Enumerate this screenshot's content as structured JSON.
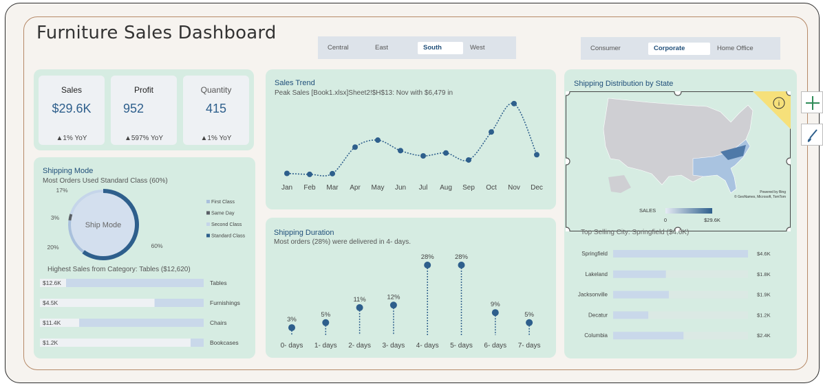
{
  "dashboard": {
    "title": "Furniture Sales Dashboard"
  },
  "region_slicer": {
    "options": [
      "Central",
      "East",
      "South",
      "West"
    ],
    "selected": "South"
  },
  "segment_slicer": {
    "options": [
      "Consumer",
      "Corporate",
      "Home Office"
    ],
    "selected": "Corporate"
  },
  "kpis": [
    {
      "label": "Sales",
      "value": "$29.6K",
      "yoy": "▲1% YoY"
    },
    {
      "label": "Profit",
      "value": "952",
      "yoy": "▲597% YoY"
    },
    {
      "label": "Quantity",
      "value": "415",
      "yoy": "▲1% YoY"
    }
  ],
  "sales_trend": {
    "title": "Sales Trend",
    "subtitle": "Peak Sales [Book1.xlsx]Sheet2!$H$13: Nov with $6,479 in",
    "chart_data": {
      "type": "line",
      "categories": [
        "Jan",
        "Feb",
        "Mar",
        "Apr",
        "May",
        "Jun",
        "Jul",
        "Aug",
        "Sep",
        "Oct",
        "Nov",
        "Dec"
      ],
      "values": [
        500,
        420,
        480,
        2750,
        3350,
        2450,
        2000,
        2250,
        1650,
        4050,
        6479,
        2100
      ],
      "ylim": [
        0,
        7000
      ],
      "color": "#2e5f8c"
    }
  },
  "shipping_mode": {
    "title": "Shipping Mode",
    "subtitle": "Most Orders Used Standard Class (60%)",
    "center_label": "Ship Mode",
    "chart_data": {
      "type": "pie",
      "categories": [
        "First Class",
        "Same Day",
        "Second Class",
        "Standard Class"
      ],
      "values": [
        17,
        3,
        20,
        60
      ],
      "labels": [
        "17%",
        "3%",
        "20%",
        "60%"
      ],
      "colors": [
        "#a9c0dc",
        "#5a5f66",
        "#c5d5ea",
        "#2e5f8c"
      ]
    }
  },
  "category_sales": {
    "title": "Highest Sales from Category: Tables ($12,620)",
    "chart_data": {
      "type": "bar",
      "categories": [
        "Tables",
        "Furnishings",
        "Chairs",
        "Bookcases"
      ],
      "values": [
        12.6,
        4.5,
        11.4,
        1.2
      ],
      "labels": [
        "$12.6K",
        "$4.5K",
        "$11.4K",
        "$1.2K"
      ]
    }
  },
  "shipping_duration": {
    "title": "Shipping Duration",
    "subtitle": "Most orders (28%) were delivered in 4- days.",
    "chart_data": {
      "type": "scatter",
      "categories": [
        "0- days",
        "1- days",
        "2- days",
        "3- days",
        "4- days",
        "5- days",
        "6- days",
        "7- days"
      ],
      "values": [
        3,
        5,
        11,
        12,
        28,
        28,
        9,
        5
      ],
      "labels": [
        "3%",
        "5%",
        "11%",
        "12%",
        "28%",
        "28%",
        "9%",
        "5%"
      ]
    }
  },
  "shipping_map": {
    "title": "Shipping Distribution by State",
    "legend_label": "SALES",
    "legend_min": "0",
    "legend_max": "$29.6K",
    "credit1": "Powered by Bing",
    "credit2": "© GeoNames, Microsoft, TomTom",
    "info_icon": "i"
  },
  "top_cities": {
    "title": "Top Selling City: Springfield ($4.6K)",
    "chart_data": {
      "type": "bar",
      "categories": [
        "Springfield",
        "Lakeland",
        "Jacksonville",
        "Decatur",
        "Columbia"
      ],
      "values": [
        4.6,
        1.8,
        1.9,
        1.2,
        2.4
      ],
      "labels": [
        "$4.6K",
        "$1.8K",
        "$1.9K",
        "$1.2K",
        "$2.4K"
      ]
    }
  },
  "side_toolbar": {
    "add_icon": "plus-icon",
    "style_icon": "brush-icon"
  }
}
